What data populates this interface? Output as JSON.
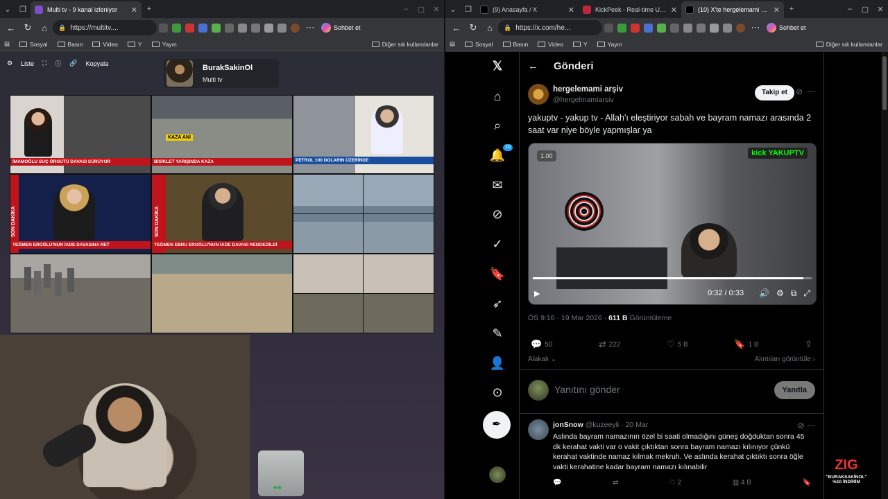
{
  "left_browser": {
    "tab_title": "Multi tv - 9 kanal izleniyor",
    "url": "https://multitv....",
    "copilot_label": "Sohbet et",
    "bookmarks": [
      "Sosyal",
      "Basın",
      "Video",
      "Y",
      "Yayın"
    ],
    "other_favorites": "Diğer sık kullanılanlar"
  },
  "multitv": {
    "toolbar": {
      "list_label": "Liste",
      "copy_label": "Kopyala"
    },
    "profile": {
      "name": "BurakSakinOl",
      "subtitle": "Multi tv"
    },
    "cells": [
      {
        "ticker": "İMAMOĞLU SUÇ ÖRGÜTÜ DAVASI SÜRÜYOR",
        "ticker_color": "#c0141c"
      },
      {
        "ticker": "BİSİKLET YARIŞINDA KAZA",
        "ticker_color": "#c0141c",
        "label": "KAZA ANI"
      },
      {
        "ticker": "PETROL 100 DOLARIN ÜZERİNDE",
        "ticker_color": "#1a4fa0"
      },
      {
        "ticker": "TEĞMEN EROĞLU'NUN İADE DAVASINA RET",
        "ticker_color": "#c0141c",
        "side": "SON DAKİKA"
      },
      {
        "ticker": "TEĞMEN EBRU EROĞLU'NUN İADE DAVASI REDDEDİLDİ",
        "ticker_color": "#c0141c",
        "side": "SON DAKİKA"
      },
      {
        "ticker": "",
        "ticker_color": "#000000"
      },
      {
        "ticker": "",
        "ticker_color": "#000000"
      },
      {
        "ticker": "",
        "ticker_color": "#000000"
      },
      {
        "ticker": "",
        "ticker_color": "#000000"
      }
    ]
  },
  "right_browser": {
    "tabs": [
      "(9) Anasayfa / X",
      "KickPeek - Real-time URL Craw...",
      "(10) X'te hergelemami arşiv: \"y..."
    ],
    "url": "https://x.com/he...",
    "copilot_label": "Sohbet et",
    "bookmarks": [
      "Sosyal",
      "Basın",
      "Video",
      "Y",
      "Yayın"
    ],
    "other_favorites": "Diğer sık kullanılanlar"
  },
  "x": {
    "nav_badge": "10",
    "header_title": "Gönderi",
    "author_name": "hergelemami arşiv",
    "author_handle": "@hergelmamiarsiv",
    "follow_label": "Takip et",
    "tweet_text": "yakuptv -  yakup tv - Allah'ı  eleştiriyor sabah ve bayram namazı arasında 2 saat var niye böyle yapmışlar ya",
    "video": {
      "speed": "1.00",
      "time": "0:32 / 0:33",
      "logo": "kick YAKUPTV",
      "progress": 0.97
    },
    "meta_time": "ÖS 9:16 · 19 Mar 2026 · ",
    "meta_views": "611 B",
    "meta_views_label": " Görüntüleme",
    "actions": {
      "replies": "50",
      "reposts": "222",
      "likes": "5 B",
      "bookmarks": "1 B"
    },
    "sort_label": "Alakalı",
    "quotes_label": "Alıntıları görüntüle",
    "reply_placeholder": "Yanıtını gönder",
    "reply_button": "Yanıtla",
    "reply": {
      "name": "jonSnow",
      "handle": "@kuzeeyli · 20 Mar",
      "text": "Aslında bayram namazının özel bi saati olmadığını güneş doğduktan sonra 45 dk kerahat vakti var o vakit çıktıktan sonra bayram namazı kılınıyor çünkü kerahat vaktinde namaz kılmak mekruh. Ve aslında kerahat çıktıktı sonra öğle vakti kerahatine kadar bayram namazı kılınabilir",
      "likes": "2",
      "views": "4 B"
    }
  },
  "promo": {
    "brand": "ZIG",
    "line1": "\"BURAKSAKİNOL\"",
    "line2": "%10 İNDİRİM"
  }
}
